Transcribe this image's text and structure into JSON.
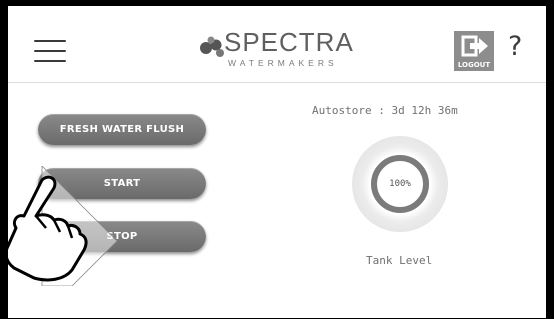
{
  "header": {
    "logo_brand": "SPECTRA",
    "logo_sub": "WATERMAKERS",
    "logout_label": "LOGOUT",
    "help_label": "?"
  },
  "controls": {
    "fresh_water_flush": "FRESH WATER FLUSH",
    "start": "START",
    "stop": "STOP"
  },
  "status": {
    "autostore": "Autostore : 3d 12h 36m",
    "tank_value": "100%",
    "tank_fraction": 1.0,
    "tank_label": "Tank Level"
  },
  "icons": [
    "menu-icon",
    "spectra-logo-icon",
    "logout-icon",
    "help-icon",
    "pointing-hand-icon"
  ],
  "colors": {
    "button": "#7a7a7a",
    "gauge_ring": "#7b7b7b",
    "text_gray": "#707070"
  }
}
